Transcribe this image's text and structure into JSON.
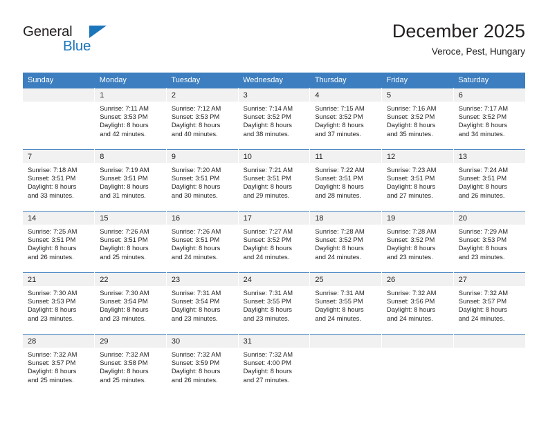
{
  "brand": {
    "name_part1": "General",
    "name_part2": "Blue",
    "triangle_color": "#1b75bb",
    "text_color": "#231f20"
  },
  "header": {
    "title": "December 2025",
    "subtitle": "Veroce, Pest, Hungary"
  },
  "colors": {
    "header_row_bg": "#3c7ebf",
    "header_row_text": "#ffffff",
    "daynum_band_bg": "#f1f1f1",
    "body_text": "#231f20",
    "week_divider": "#3c7ebf"
  },
  "weekday_headers": [
    "Sunday",
    "Monday",
    "Tuesday",
    "Wednesday",
    "Thursday",
    "Friday",
    "Saturday"
  ],
  "weeks": [
    [
      {
        "day": "",
        "lines": []
      },
      {
        "day": "1",
        "lines": [
          "Sunrise: 7:11 AM",
          "Sunset: 3:53 PM",
          "Daylight: 8 hours",
          "and 42 minutes."
        ]
      },
      {
        "day": "2",
        "lines": [
          "Sunrise: 7:12 AM",
          "Sunset: 3:53 PM",
          "Daylight: 8 hours",
          "and 40 minutes."
        ]
      },
      {
        "day": "3",
        "lines": [
          "Sunrise: 7:14 AM",
          "Sunset: 3:52 PM",
          "Daylight: 8 hours",
          "and 38 minutes."
        ]
      },
      {
        "day": "4",
        "lines": [
          "Sunrise: 7:15 AM",
          "Sunset: 3:52 PM",
          "Daylight: 8 hours",
          "and 37 minutes."
        ]
      },
      {
        "day": "5",
        "lines": [
          "Sunrise: 7:16 AM",
          "Sunset: 3:52 PM",
          "Daylight: 8 hours",
          "and 35 minutes."
        ]
      },
      {
        "day": "6",
        "lines": [
          "Sunrise: 7:17 AM",
          "Sunset: 3:52 PM",
          "Daylight: 8 hours",
          "and 34 minutes."
        ]
      }
    ],
    [
      {
        "day": "7",
        "lines": [
          "Sunrise: 7:18 AM",
          "Sunset: 3:51 PM",
          "Daylight: 8 hours",
          "and 33 minutes."
        ]
      },
      {
        "day": "8",
        "lines": [
          "Sunrise: 7:19 AM",
          "Sunset: 3:51 PM",
          "Daylight: 8 hours",
          "and 31 minutes."
        ]
      },
      {
        "day": "9",
        "lines": [
          "Sunrise: 7:20 AM",
          "Sunset: 3:51 PM",
          "Daylight: 8 hours",
          "and 30 minutes."
        ]
      },
      {
        "day": "10",
        "lines": [
          "Sunrise: 7:21 AM",
          "Sunset: 3:51 PM",
          "Daylight: 8 hours",
          "and 29 minutes."
        ]
      },
      {
        "day": "11",
        "lines": [
          "Sunrise: 7:22 AM",
          "Sunset: 3:51 PM",
          "Daylight: 8 hours",
          "and 28 minutes."
        ]
      },
      {
        "day": "12",
        "lines": [
          "Sunrise: 7:23 AM",
          "Sunset: 3:51 PM",
          "Daylight: 8 hours",
          "and 27 minutes."
        ]
      },
      {
        "day": "13",
        "lines": [
          "Sunrise: 7:24 AM",
          "Sunset: 3:51 PM",
          "Daylight: 8 hours",
          "and 26 minutes."
        ]
      }
    ],
    [
      {
        "day": "14",
        "lines": [
          "Sunrise: 7:25 AM",
          "Sunset: 3:51 PM",
          "Daylight: 8 hours",
          "and 26 minutes."
        ]
      },
      {
        "day": "15",
        "lines": [
          "Sunrise: 7:26 AM",
          "Sunset: 3:51 PM",
          "Daylight: 8 hours",
          "and 25 minutes."
        ]
      },
      {
        "day": "16",
        "lines": [
          "Sunrise: 7:26 AM",
          "Sunset: 3:51 PM",
          "Daylight: 8 hours",
          "and 24 minutes."
        ]
      },
      {
        "day": "17",
        "lines": [
          "Sunrise: 7:27 AM",
          "Sunset: 3:52 PM",
          "Daylight: 8 hours",
          "and 24 minutes."
        ]
      },
      {
        "day": "18",
        "lines": [
          "Sunrise: 7:28 AM",
          "Sunset: 3:52 PM",
          "Daylight: 8 hours",
          "and 24 minutes."
        ]
      },
      {
        "day": "19",
        "lines": [
          "Sunrise: 7:28 AM",
          "Sunset: 3:52 PM",
          "Daylight: 8 hours",
          "and 23 minutes."
        ]
      },
      {
        "day": "20",
        "lines": [
          "Sunrise: 7:29 AM",
          "Sunset: 3:53 PM",
          "Daylight: 8 hours",
          "and 23 minutes."
        ]
      }
    ],
    [
      {
        "day": "21",
        "lines": [
          "Sunrise: 7:30 AM",
          "Sunset: 3:53 PM",
          "Daylight: 8 hours",
          "and 23 minutes."
        ]
      },
      {
        "day": "22",
        "lines": [
          "Sunrise: 7:30 AM",
          "Sunset: 3:54 PM",
          "Daylight: 8 hours",
          "and 23 minutes."
        ]
      },
      {
        "day": "23",
        "lines": [
          "Sunrise: 7:31 AM",
          "Sunset: 3:54 PM",
          "Daylight: 8 hours",
          "and 23 minutes."
        ]
      },
      {
        "day": "24",
        "lines": [
          "Sunrise: 7:31 AM",
          "Sunset: 3:55 PM",
          "Daylight: 8 hours",
          "and 23 minutes."
        ]
      },
      {
        "day": "25",
        "lines": [
          "Sunrise: 7:31 AM",
          "Sunset: 3:55 PM",
          "Daylight: 8 hours",
          "and 24 minutes."
        ]
      },
      {
        "day": "26",
        "lines": [
          "Sunrise: 7:32 AM",
          "Sunset: 3:56 PM",
          "Daylight: 8 hours",
          "and 24 minutes."
        ]
      },
      {
        "day": "27",
        "lines": [
          "Sunrise: 7:32 AM",
          "Sunset: 3:57 PM",
          "Daylight: 8 hours",
          "and 24 minutes."
        ]
      }
    ],
    [
      {
        "day": "28",
        "lines": [
          "Sunrise: 7:32 AM",
          "Sunset: 3:57 PM",
          "Daylight: 8 hours",
          "and 25 minutes."
        ]
      },
      {
        "day": "29",
        "lines": [
          "Sunrise: 7:32 AM",
          "Sunset: 3:58 PM",
          "Daylight: 8 hours",
          "and 25 minutes."
        ]
      },
      {
        "day": "30",
        "lines": [
          "Sunrise: 7:32 AM",
          "Sunset: 3:59 PM",
          "Daylight: 8 hours",
          "and 26 minutes."
        ]
      },
      {
        "day": "31",
        "lines": [
          "Sunrise: 7:32 AM",
          "Sunset: 4:00 PM",
          "Daylight: 8 hours",
          "and 27 minutes."
        ]
      },
      {
        "day": "",
        "lines": []
      },
      {
        "day": "",
        "lines": []
      },
      {
        "day": "",
        "lines": []
      }
    ]
  ]
}
